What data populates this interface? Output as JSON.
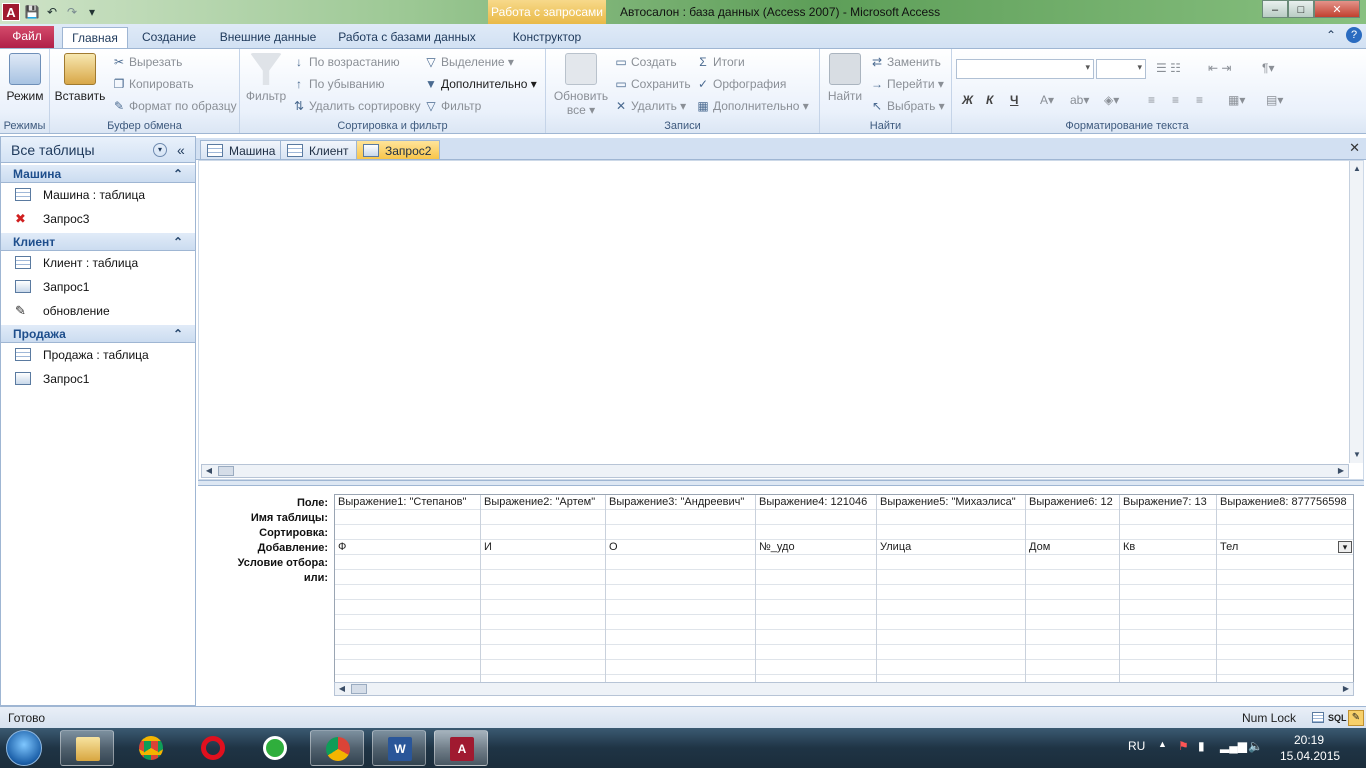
{
  "window": {
    "title": "Автосалон : база данных (Access 2007)  -  Microsoft Access",
    "contextual_tab": "Работа с запросами",
    "app_icon_letter": "A",
    "controls": {
      "minimize": "–",
      "maximize": "□",
      "close": "✕"
    }
  },
  "ribbon_tabs": {
    "file": "Файл",
    "home": "Главная",
    "create": "Создание",
    "external": "Внешние данные",
    "database": "Работа с базами данных",
    "design": "Конструктор"
  },
  "groups": {
    "views": {
      "label": "Режимы",
      "mode": "Режим"
    },
    "clipboard": {
      "label": "Буфер обмена",
      "paste": "Вставить",
      "cut": "Вырезать",
      "copy": "Копировать",
      "format_painter": "Формат по образцу"
    },
    "sort_filter": {
      "label": "Сортировка и фильтр",
      "filter": "Фильтр",
      "ascending": "По возрастанию",
      "descending": "По убыванию",
      "remove_sort": "Удалить сортировку",
      "selection": "Выделение",
      "advanced": "Дополнительно",
      "toggle_filter": "Фильтр"
    },
    "records": {
      "label": "Записи",
      "refresh": "Обновить",
      "refresh2": "все",
      "new": "Создать",
      "save": "Сохранить",
      "delete": "Удалить",
      "totals": "Итоги",
      "spelling": "Орфография",
      "more": "Дополнительно"
    },
    "find": {
      "label": "Найти",
      "find": "Найти",
      "replace": "Заменить",
      "goto": "Перейти",
      "select": "Выбрать"
    },
    "text_format": {
      "label": "Форматирование текста",
      "bold": "Ж",
      "italic": "К",
      "underline": "Ч"
    }
  },
  "nav": {
    "header": "Все таблицы",
    "groups": [
      {
        "title": "Машина",
        "items": [
          {
            "label": "Машина : таблица",
            "icon": "table-icon"
          },
          {
            "label": "Запрос3",
            "icon": "delete-query-icon"
          }
        ]
      },
      {
        "title": "Клиент",
        "items": [
          {
            "label": "Клиент : таблица",
            "icon": "table-icon"
          },
          {
            "label": "Запрос1",
            "icon": "query-icon"
          },
          {
            "label": "обновление",
            "icon": "update-query-icon"
          }
        ]
      },
      {
        "title": "Продажа",
        "items": [
          {
            "label": "Продажа : таблица",
            "icon": "table-icon"
          },
          {
            "label": "Запрос1",
            "icon": "query-icon"
          }
        ]
      }
    ]
  },
  "doc_tabs": [
    "Машина",
    "Клиент",
    "Запрос2"
  ],
  "design_grid": {
    "row_labels": [
      "Поле:",
      "Имя таблицы:",
      "Сортировка:",
      "Добавление:",
      "Условие отбора:",
      "или:"
    ],
    "columns": [
      {
        "field": "Выражение1: \"Степанов\"",
        "append": "Ф"
      },
      {
        "field": "Выражение2: \"Артем\"",
        "append": "И"
      },
      {
        "field": "Выражение3: \"Андреевич\"",
        "append": "О"
      },
      {
        "field": "Выражение4: 121046",
        "append": "№_удо"
      },
      {
        "field": "Выражение5: \"Михаэлиса\"",
        "append": "Улица"
      },
      {
        "field": "Выражение6: 12",
        "append": "Дом"
      },
      {
        "field": "Выражение7: 13",
        "append": "Кв"
      },
      {
        "field": "Выражение8: 877756598",
        "append": "Тел"
      }
    ]
  },
  "status": {
    "ready": "Готово",
    "numlock": "Num Lock",
    "sql": "SQL"
  },
  "taskbar": {
    "lang": "RU",
    "time": "20:19",
    "date": "15.04.2015"
  }
}
